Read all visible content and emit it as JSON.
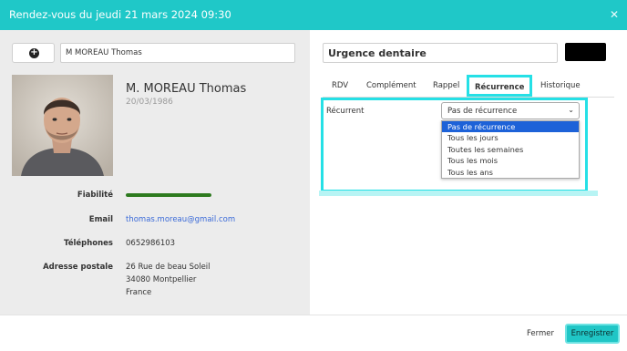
{
  "header": {
    "title": "Rendez-vous du jeudi 21 mars 2024 09:30",
    "close_icon": "close-icon"
  },
  "left": {
    "add_button_icon": "plus-circle-icon",
    "patient_search_value": "M MOREAU Thomas",
    "patient": {
      "name": "M. MOREAU Thomas",
      "dob": "20/03/1986"
    },
    "fields": {
      "fiabilite_label": "Fiabilité",
      "fiabilite_level": 1.0,
      "email_label": "Email",
      "email_value": "thomas.moreau@gmail.com",
      "telephones_label": "Téléphones",
      "telephones_value": "0652986103",
      "adresse_label": "Adresse postale",
      "adresse_line1": "26 Rue de beau Soleil",
      "adresse_line2": "34080 Montpellier",
      "adresse_line3": "France"
    }
  },
  "right": {
    "title_value": "Urgence dentaire",
    "tabs": [
      {
        "label": "RDV"
      },
      {
        "label": "Complément"
      },
      {
        "label": "Rappel"
      },
      {
        "label": "Récurrence"
      },
      {
        "label": "Historique"
      }
    ],
    "active_tab": "Récurrence",
    "recurrence": {
      "label": "Récurrent",
      "selected": "Pas de récurrence",
      "options": [
        "Pas de récurrence",
        "Tous les jours",
        "Toutes les semaines",
        "Tous les mois",
        "Tous les ans"
      ]
    }
  },
  "footer": {
    "close_label": "Fermer",
    "save_label": "Enregistrer"
  },
  "colors": {
    "accent": "#1fc8c8",
    "highlight": "#25e0e6",
    "link": "#3a6ad8",
    "selected_option": "#1d62d8",
    "fiabilite": "#2d7a1e"
  }
}
